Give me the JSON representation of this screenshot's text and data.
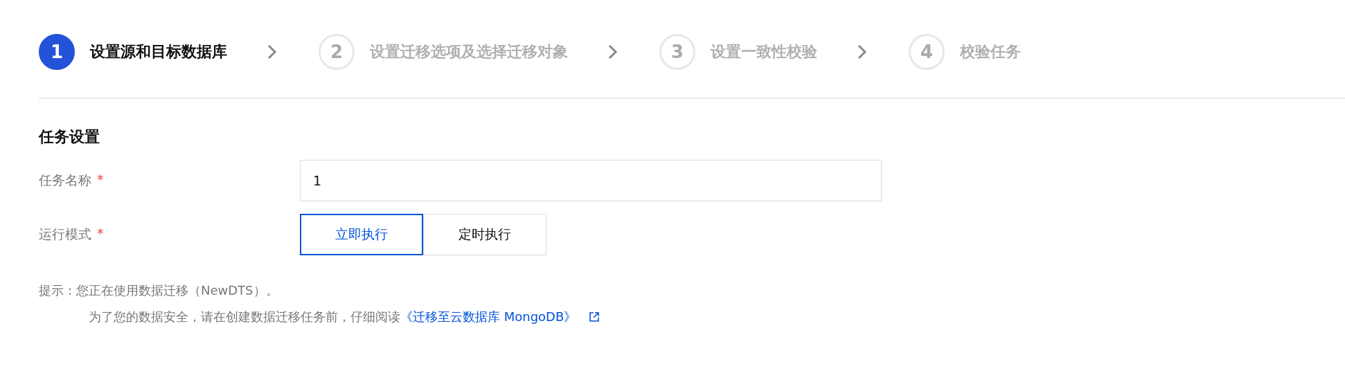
{
  "steps": [
    {
      "number": "1",
      "label": "设置源和目标数据库",
      "selected": true
    },
    {
      "number": "2",
      "label": "设置迁移选项及选择迁移对象",
      "selected": false
    },
    {
      "number": "3",
      "label": "设置一致性校验",
      "selected": false
    },
    {
      "number": "4",
      "label": "校验任务",
      "selected": false
    }
  ],
  "section_title": "任务设置",
  "fields": [
    {
      "kind": "input",
      "label": "任务名称",
      "required_mark": "*",
      "value": "1"
    },
    {
      "kind": "segmented",
      "label": "运行模式",
      "required_mark": "*",
      "options": [
        {
          "label": "立即执行",
          "selected": true
        },
        {
          "label": "定时执行",
          "selected": false
        }
      ]
    }
  ],
  "tip": {
    "prefix": "提示：",
    "line_1": "您正在使用数据迁移（NewDTS）。",
    "line_2": "为了您的数据安全，请在创建数据迁移任务前，仔细阅读",
    "link": "《迁移至云数据库 MongoDB》"
  }
}
